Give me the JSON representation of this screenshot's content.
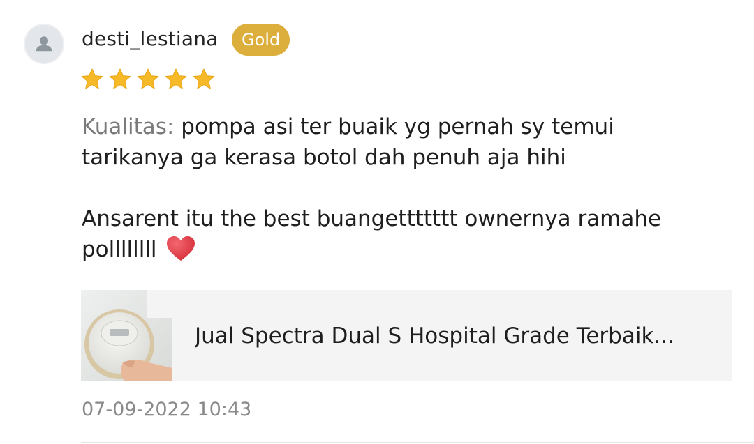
{
  "review": {
    "username": "desti_lestiana",
    "badge": "Gold",
    "rating": 5,
    "rating_max": 5,
    "quality_label": "Kualitas:",
    "line1": " pompa asi ter buaik yg pernah sy temui",
    "line2": "tarikanya ga kerasa botol dah penuh aja hihi",
    "line3": "Ansarent itu the best buangettttttt ownernya ramahe",
    "line4": "pollllllll",
    "emoji": "heart",
    "timestamp": "07-09-2022 10:43"
  },
  "product": {
    "name": "Jual Spectra Dual S Hospital Grade Terbaik..."
  },
  "colors": {
    "badge": "#dcae3b",
    "star": "#f6b928",
    "heart": "#e0333e",
    "muted_text": "#7a7a7a",
    "card_bg": "#f4f4f4"
  }
}
